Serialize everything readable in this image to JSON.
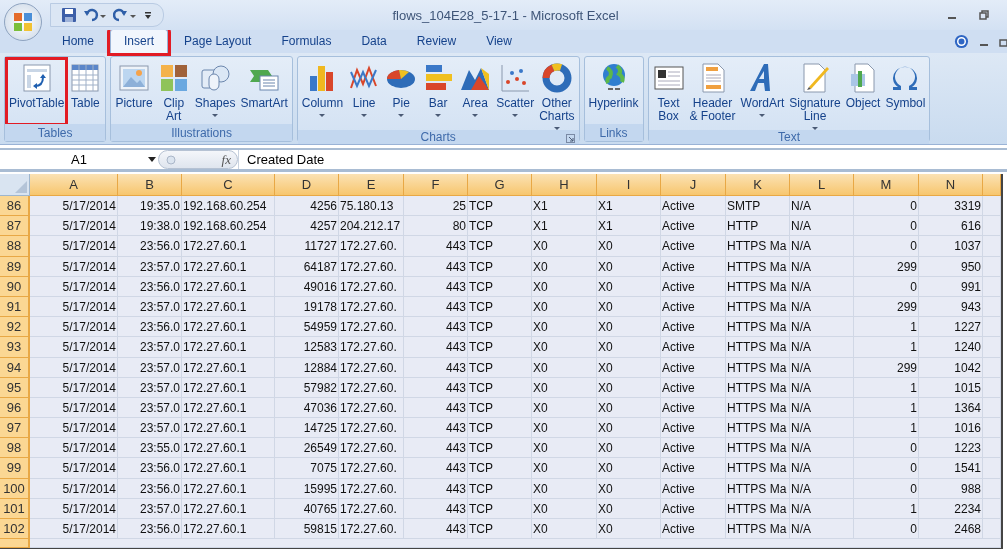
{
  "window": {
    "title": "flows_104E28_5-17-1 - Microsoft Excel"
  },
  "tabs": [
    {
      "label": "Home",
      "selected": false,
      "highlighted": false
    },
    {
      "label": "Insert",
      "selected": true,
      "highlighted": true
    },
    {
      "label": "Page Layout",
      "selected": false,
      "highlighted": false
    },
    {
      "label": "Formulas",
      "selected": false,
      "highlighted": false
    },
    {
      "label": "Data",
      "selected": false,
      "highlighted": false
    },
    {
      "label": "Review",
      "selected": false,
      "highlighted": false
    },
    {
      "label": "View",
      "selected": false,
      "highlighted": false
    }
  ],
  "ribbon": {
    "groups": [
      {
        "name": "Tables",
        "launcher": false,
        "buttons": [
          {
            "label": "PivotTable",
            "dropdown": false,
            "highlighted": true
          },
          {
            "label": "Table",
            "dropdown": false,
            "highlighted": false
          }
        ]
      },
      {
        "name": "Illustrations",
        "launcher": false,
        "buttons": [
          {
            "label": "Picture",
            "dropdown": false,
            "highlighted": false
          },
          {
            "label": "Clip\nArt",
            "dropdown": false,
            "highlighted": false
          },
          {
            "label": "Shapes",
            "dropdown": true,
            "highlighted": false
          },
          {
            "label": "SmartArt",
            "dropdown": false,
            "highlighted": false
          }
        ]
      },
      {
        "name": "Charts",
        "launcher": true,
        "buttons": [
          {
            "label": "Column",
            "dropdown": true,
            "highlighted": false
          },
          {
            "label": "Line",
            "dropdown": true,
            "highlighted": false
          },
          {
            "label": "Pie",
            "dropdown": true,
            "highlighted": false
          },
          {
            "label": "Bar",
            "dropdown": true,
            "highlighted": false
          },
          {
            "label": "Area",
            "dropdown": true,
            "highlighted": false
          },
          {
            "label": "Scatter",
            "dropdown": true,
            "highlighted": false
          },
          {
            "label": "Other\nCharts",
            "dropdown": true,
            "highlighted": false
          }
        ]
      },
      {
        "name": "Links",
        "launcher": false,
        "buttons": [
          {
            "label": "Hyperlink",
            "dropdown": false,
            "highlighted": false
          }
        ]
      },
      {
        "name": "Text",
        "launcher": false,
        "buttons": [
          {
            "label": "Text\nBox",
            "dropdown": false,
            "highlighted": false
          },
          {
            "label": "Header\n& Footer",
            "dropdown": false,
            "highlighted": false
          },
          {
            "label": "WordArt",
            "dropdown": true,
            "highlighted": false
          },
          {
            "label": "Signature\nLine",
            "dropdown": true,
            "highlighted": false
          },
          {
            "label": "Object",
            "dropdown": false,
            "highlighted": false
          },
          {
            "label": "Symbol",
            "dropdown": false,
            "highlighted": false
          }
        ]
      }
    ]
  },
  "formula_bar": {
    "name_box": "A1",
    "function_label": "fx",
    "value": "Created Date"
  },
  "sheet": {
    "columns": [
      {
        "label": "A",
        "kind": "number"
      },
      {
        "label": "B",
        "kind": "number"
      },
      {
        "label": "C",
        "kind": "text"
      },
      {
        "label": "D",
        "kind": "number"
      },
      {
        "label": "E",
        "kind": "text"
      },
      {
        "label": "F",
        "kind": "number"
      },
      {
        "label": "G",
        "kind": "text"
      },
      {
        "label": "H",
        "kind": "text"
      },
      {
        "label": "I",
        "kind": "text"
      },
      {
        "label": "J",
        "kind": "text"
      },
      {
        "label": "K",
        "kind": "text"
      },
      {
        "label": "L",
        "kind": "text"
      },
      {
        "label": "M",
        "kind": "number"
      },
      {
        "label": "N",
        "kind": "number"
      }
    ],
    "rows": [
      {
        "header": "86",
        "cells": [
          "5/17/2014",
          "19:35.0",
          "192.168.60.254",
          "4256",
          "75.180.13",
          "25",
          "TCP",
          "X1",
          "X1",
          "Active",
          "SMTP",
          "N/A",
          "0",
          "3319"
        ]
      },
      {
        "header": "87",
        "cells": [
          "5/17/2014",
          "19:38.0",
          "192.168.60.254",
          "4257",
          "204.212.17",
          "80",
          "TCP",
          "X1",
          "X1",
          "Active",
          "HTTP",
          "N/A",
          "0",
          "616"
        ]
      },
      {
        "header": "88",
        "cells": [
          "5/17/2014",
          "23:56.0",
          "172.27.60.1",
          "11727",
          "172.27.60.",
          "443",
          "TCP",
          "X0",
          "X0",
          "Active",
          "HTTPS Ma",
          "N/A",
          "0",
          "1037"
        ]
      },
      {
        "header": "89",
        "cells": [
          "5/17/2014",
          "23:57.0",
          "172.27.60.1",
          "64187",
          "172.27.60.",
          "443",
          "TCP",
          "X0",
          "X0",
          "Active",
          "HTTPS Ma",
          "N/A",
          "299",
          "950"
        ]
      },
      {
        "header": "90",
        "cells": [
          "5/17/2014",
          "23:56.0",
          "172.27.60.1",
          "49016",
          "172.27.60.",
          "443",
          "TCP",
          "X0",
          "X0",
          "Active",
          "HTTPS Ma",
          "N/A",
          "0",
          "991"
        ]
      },
      {
        "header": "91",
        "cells": [
          "5/17/2014",
          "23:57.0",
          "172.27.60.1",
          "19178",
          "172.27.60.",
          "443",
          "TCP",
          "X0",
          "X0",
          "Active",
          "HTTPS Ma",
          "N/A",
          "299",
          "943"
        ]
      },
      {
        "header": "92",
        "cells": [
          "5/17/2014",
          "23:56.0",
          "172.27.60.1",
          "54959",
          "172.27.60.",
          "443",
          "TCP",
          "X0",
          "X0",
          "Active",
          "HTTPS Ma",
          "N/A",
          "1",
          "1227"
        ]
      },
      {
        "header": "93",
        "cells": [
          "5/17/2014",
          "23:57.0",
          "172.27.60.1",
          "12583",
          "172.27.60.",
          "443",
          "TCP",
          "X0",
          "X0",
          "Active",
          "HTTPS Ma",
          "N/A",
          "1",
          "1240"
        ]
      },
      {
        "header": "94",
        "cells": [
          "5/17/2014",
          "23:57.0",
          "172.27.60.1",
          "12884",
          "172.27.60.",
          "443",
          "TCP",
          "X0",
          "X0",
          "Active",
          "HTTPS Ma",
          "N/A",
          "299",
          "1042"
        ]
      },
      {
        "header": "95",
        "cells": [
          "5/17/2014",
          "23:57.0",
          "172.27.60.1",
          "57982",
          "172.27.60.",
          "443",
          "TCP",
          "X0",
          "X0",
          "Active",
          "HTTPS Ma",
          "N/A",
          "1",
          "1015"
        ]
      },
      {
        "header": "96",
        "cells": [
          "5/17/2014",
          "23:57.0",
          "172.27.60.1",
          "47036",
          "172.27.60.",
          "443",
          "TCP",
          "X0",
          "X0",
          "Active",
          "HTTPS Ma",
          "N/A",
          "1",
          "1364"
        ]
      },
      {
        "header": "97",
        "cells": [
          "5/17/2014",
          "23:57.0",
          "172.27.60.1",
          "14725",
          "172.27.60.",
          "443",
          "TCP",
          "X0",
          "X0",
          "Active",
          "HTTPS Ma",
          "N/A",
          "1",
          "1016"
        ]
      },
      {
        "header": "98",
        "cells": [
          "5/17/2014",
          "23:55.0",
          "172.27.60.1",
          "26549",
          "172.27.60.",
          "443",
          "TCP",
          "X0",
          "X0",
          "Active",
          "HTTPS Ma",
          "N/A",
          "0",
          "1223"
        ]
      },
      {
        "header": "99",
        "cells": [
          "5/17/2014",
          "23:56.0",
          "172.27.60.1",
          "7075",
          "172.27.60.",
          "443",
          "TCP",
          "X0",
          "X0",
          "Active",
          "HTTPS Ma",
          "N/A",
          "0",
          "1541"
        ]
      },
      {
        "header": "100",
        "cells": [
          "5/17/2014",
          "23:56.0",
          "172.27.60.1",
          "15995",
          "172.27.60.",
          "443",
          "TCP",
          "X0",
          "X0",
          "Active",
          "HTTPS Ma",
          "N/A",
          "0",
          "988"
        ]
      },
      {
        "header": "101",
        "cells": [
          "5/17/2014",
          "23:57.0",
          "172.27.60.1",
          "40765",
          "172.27.60.",
          "443",
          "TCP",
          "X0",
          "X0",
          "Active",
          "HTTPS Ma",
          "N/A",
          "1",
          "2234"
        ]
      },
      {
        "header": "102",
        "cells": [
          "5/17/2014",
          "23:56.0",
          "172.27.60.1",
          "59815",
          "172.27.60.",
          "443",
          "TCP",
          "X0",
          "X0",
          "Active",
          "HTTPS Ma",
          "N/A",
          "0",
          "2468"
        ]
      }
    ]
  }
}
